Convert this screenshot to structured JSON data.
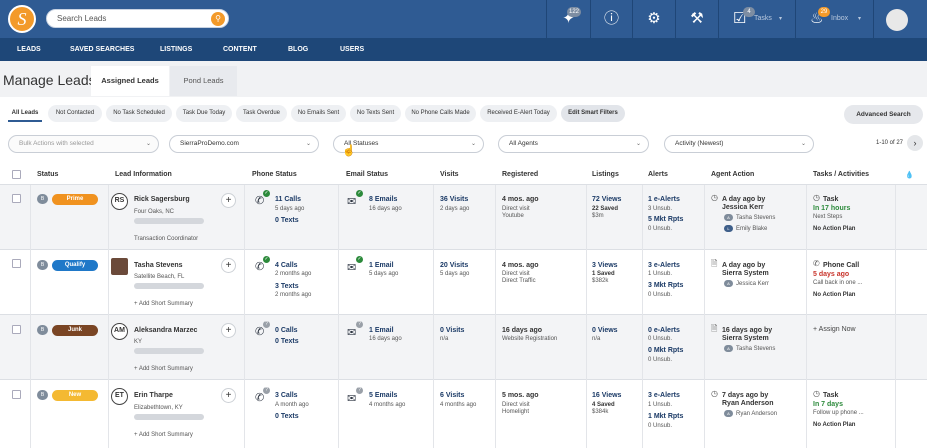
{
  "topbar": {
    "logo": "S",
    "search_placeholder": "Search Leads",
    "icons": [
      "radar-icon",
      "question-icon",
      "gear-icon",
      "tools-icon",
      "tasks-icon",
      "inbox-icon"
    ],
    "radar_badge": "122",
    "tasks_label": "Tasks",
    "tasks_badge": "4",
    "inbox_label": "Inbox",
    "inbox_badge": "29"
  },
  "nav": [
    "LEADS",
    "SAVED SEARCHES",
    "LISTINGS",
    "CONTENT",
    "BLOG",
    "USERS"
  ],
  "page": {
    "title": "Manage Leads",
    "tabs": [
      "Assigned Leads",
      "Pond Leads"
    ]
  },
  "filters": [
    "All Leads",
    "Not Contacted",
    "No Task Scheduled",
    "Task Due Today",
    "Task Overdue",
    "No Emails Sent",
    "No Texts Sent",
    "No Phone Calls Made",
    "Received E-Alert Today",
    "Edit Smart Filters"
  ],
  "advanced_search": "Advanced Search",
  "selects": {
    "bulk": "Bulk Actions with selected",
    "site": "SierraProDemo.com",
    "status": "All Statuses",
    "agents": "All Agents",
    "activity": "Activity (Newest)"
  },
  "pagination": "1-10 of 27",
  "columns": [
    "Status",
    "Lead Information",
    "Phone Status",
    "Email Status",
    "Visits",
    "Registered",
    "Listings",
    "Alerts",
    "Agent Action",
    "Tasks / Activities"
  ],
  "colors": {
    "prime": "#f0921f",
    "qualify": "#1f78c8",
    "junk": "#7a4524",
    "new": "#f4b932",
    "topbar": "#2f5b93",
    "nav": "#1e4778"
  },
  "leads": [
    {
      "badge": "B",
      "status": "Prime",
      "initials": "RS",
      "name": "Rick Sagersburg",
      "location": "Four Oaks, NC",
      "extra": "Transaction Coordinator",
      "phone_calls": "11 Calls",
      "phone_when": "5 days ago",
      "phone_texts": "0 Texts",
      "phone_texts_when": "",
      "email": "8 Emails",
      "email_when": "16 days ago",
      "visits": "36 Visits",
      "visits_when": "2 days ago",
      "registered": "4 mos. ago",
      "reg_source": "Direct visit",
      "reg_source2": "Youtube",
      "listings": "72 Views",
      "listings_saved": "22 Saved",
      "listings_price": "$3m",
      "alerts1": "1 e-Alerts",
      "alerts1_sub": "3 Unsub.",
      "alerts2": "5 Mkt Rpts",
      "alerts2_sub": "0 Unsub.",
      "agent_when": "A day ago by",
      "agent_name": "Jessica Kerr",
      "agent_tag1": "Tasha Stevens",
      "agent_tag2": "Emily Blake",
      "task_type": "Task",
      "task_due": "In 17 hours",
      "task_note": "Next Steps",
      "task_plan": "No Action Plan"
    },
    {
      "badge": "B",
      "status": "Qualify",
      "initials": "",
      "name": "Tasha Stevens",
      "location": "Satellite Beach, FL",
      "extra": "+ Add Short Summary",
      "phone_calls": "4 Calls",
      "phone_when": "2 months ago",
      "phone_texts": "3 Texts",
      "phone_texts_when": "2 months ago",
      "email": "1 Email",
      "email_when": "5 days ago",
      "visits": "20 Visits",
      "visits_when": "5 days ago",
      "registered": "4 mos. ago",
      "reg_source": "Direct visit",
      "reg_source2": "Direct Traffic",
      "listings": "3 Views",
      "listings_saved": "1 Saved",
      "listings_price": "$382k",
      "alerts1": "3 e-Alerts",
      "alerts1_sub": "1 Unsub.",
      "alerts2": "3 Mkt Rpts",
      "alerts2_sub": "0 Unsub.",
      "agent_when": "A day ago by",
      "agent_name": "Sierra System",
      "agent_tag1": "Jessica Kerr",
      "agent_tag2": "",
      "task_type": "Phone Call",
      "task_due": "5 days ago",
      "task_note": "Call back in one ...",
      "task_plan": "No Action Plan"
    },
    {
      "badge": "B",
      "status": "Junk",
      "initials": "AM",
      "name": "Aleksandra Marzec",
      "location": "KY",
      "extra": "+ Add Short Summary",
      "phone_calls": "0 Calls",
      "phone_when": "",
      "phone_texts": "0 Texts",
      "phone_texts_when": "",
      "email": "1 Email",
      "email_when": "16 days ago",
      "visits": "0 Visits",
      "visits_when": "n/a",
      "registered": "16 days ago",
      "reg_source": "Website Registration",
      "reg_source2": "",
      "listings": "0 Views",
      "listings_saved": "n/a",
      "listings_price": "",
      "alerts1": "0 e-Alerts",
      "alerts1_sub": "0 Unsub.",
      "alerts2": "0 Mkt Rpts",
      "alerts2_sub": "0 Unsub.",
      "agent_when": "16 days ago by",
      "agent_name": "Sierra System",
      "agent_tag1": "Tasha Stevens",
      "agent_tag2": "",
      "task_type": "+ Assign Now",
      "task_due": "",
      "task_note": "",
      "task_plan": ""
    },
    {
      "badge": "B",
      "status": "New",
      "initials": "ET",
      "name": "Erin Tharpe",
      "location": "Elizabethtown, KY",
      "extra": "+ Add Short Summary",
      "phone_calls": "3 Calls",
      "phone_when": "A month ago",
      "phone_texts": "0 Texts",
      "phone_texts_when": "",
      "email": "5 Emails",
      "email_when": "4 months ago",
      "visits": "6 Visits",
      "visits_when": "4 months ago",
      "registered": "5 mos. ago",
      "reg_source": "Direct visit",
      "reg_source2": "Homelight",
      "listings": "16 Views",
      "listings_saved": "4 Saved",
      "listings_price": "$384k",
      "alerts1": "3 e-Alerts",
      "alerts1_sub": "1 Unsub.",
      "alerts2": "1 Mkt Rpts",
      "alerts2_sub": "0 Unsub.",
      "agent_when": "7 days ago by",
      "agent_name": "Ryan Anderson",
      "agent_tag1": "Ryan Anderson",
      "agent_tag2": "",
      "task_type": "Task",
      "task_due": "In 7 days",
      "task_note": "Follow up phone ...",
      "task_plan": "No Action Plan"
    }
  ]
}
